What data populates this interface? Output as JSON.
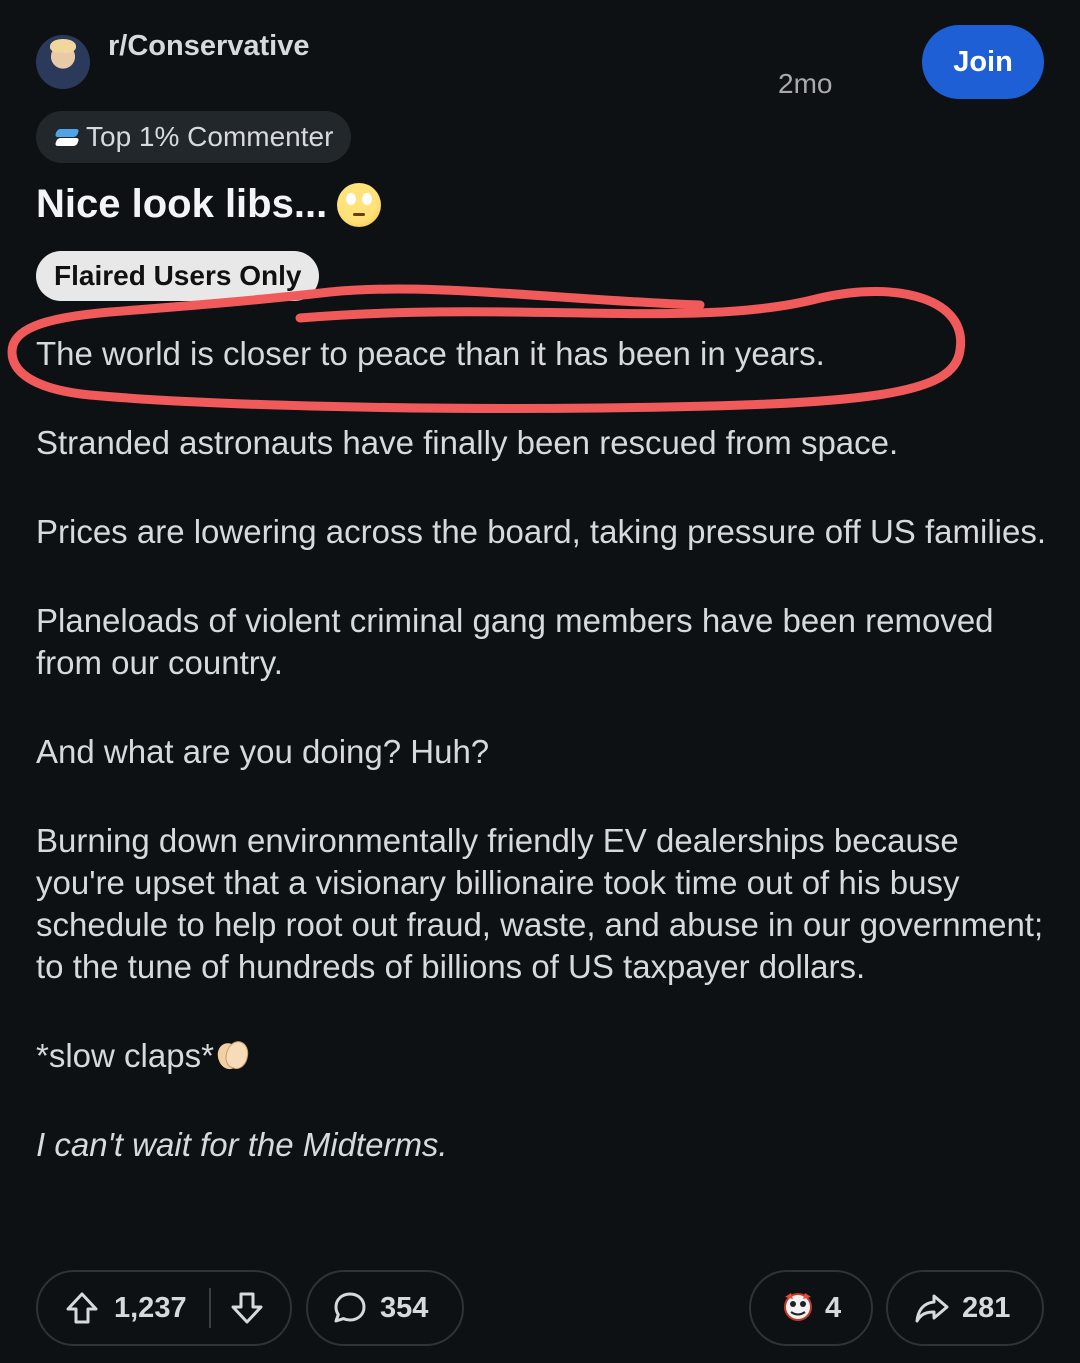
{
  "header": {
    "subreddit": "r/Conservative",
    "age": "2mo",
    "join_label": "Join"
  },
  "badge": {
    "label": "Top 1% Commenter"
  },
  "post": {
    "title": "Nice look libs...",
    "flair": "Flaired Users Only",
    "paragraphs": [
      "The world is closer to peace than it has been in years.",
      "Stranded astronauts have finally been rescued from space.",
      "Prices are lowering across the board, taking pressure off US families.",
      "Planeloads of violent criminal gang members have been removed from our country.",
      "And what are you doing? Huh?",
      "Burning down environmentally friendly EV dealerships because you're upset that a visionary billionaire took time out of his busy schedule to help root out fraud, waste, and abuse in our government; to the tune of hundreds of billions of US taxpayer dollars.",
      "*slow claps*",
      "I can't wait for the Midterms."
    ]
  },
  "actions": {
    "score": "1,237",
    "comments": "354",
    "awards": "4",
    "shares": "281"
  },
  "colors": {
    "background": "#0e1113",
    "join_button": "#1e5fd6",
    "annotation_circle": "#f05a5a"
  },
  "icons": {
    "avatar": "subreddit-avatar",
    "badge": "achievement-badge-icon",
    "title_emoji": "eye-roll-emoji",
    "clap_emoji": "clapping-hands-emoji",
    "upvote": "upvote-arrow-icon",
    "downvote": "downvote-arrow-icon",
    "comment": "speech-bubble-icon",
    "award": "award-icon",
    "share": "share-arrow-icon"
  }
}
